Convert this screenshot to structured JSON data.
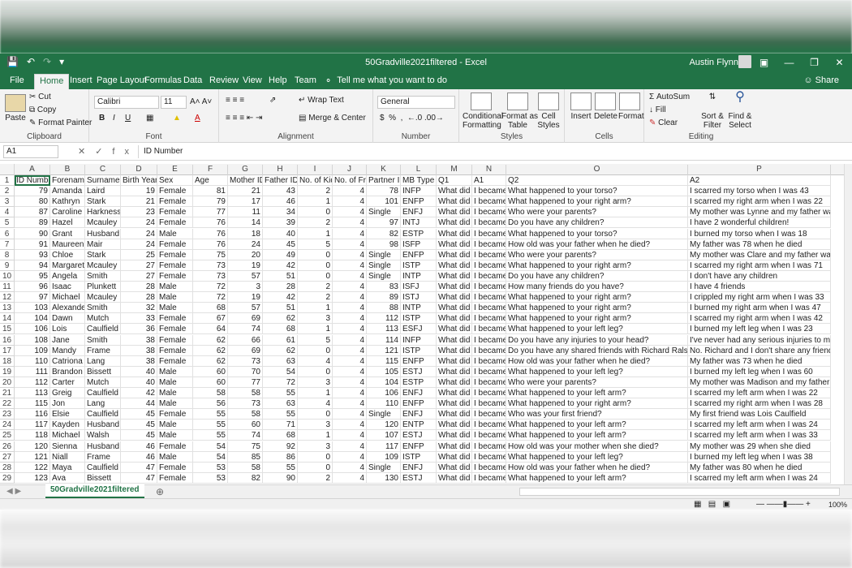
{
  "titlebar": {
    "doc_title": "50Gradville2021filtered  -  Excel",
    "user": "Austin Flynn",
    "save_icon": "save-icon",
    "undo_icon": "undo-icon",
    "redo_icon": "redo-icon"
  },
  "tabs": [
    "File",
    "Home",
    "Insert",
    "Page Layout",
    "Formulas",
    "Data",
    "Review",
    "View",
    "Help",
    "Team"
  ],
  "tellme": "Tell me what you want to do",
  "share": "Share",
  "ribbon": {
    "clipboard": {
      "label": "Clipboard",
      "paste": "Paste",
      "cut": "Cut",
      "copy": "Copy",
      "painter": "Format Painter"
    },
    "font": {
      "label": "Font",
      "name": "Calibri",
      "size": "11"
    },
    "alignment": {
      "label": "Alignment",
      "wrap": "Wrap Text",
      "merge": "Merge & Center"
    },
    "number": {
      "label": "Number",
      "format": "General"
    },
    "styles": {
      "label": "Styles",
      "cond": "Conditional\nFormatting",
      "table": "Format as\nTable",
      "cell": "Cell\nStyles"
    },
    "cells": {
      "label": "Cells",
      "insert": "Insert",
      "delete": "Delete",
      "format": "Format"
    },
    "editing": {
      "label": "Editing",
      "autosum": "AutoSum",
      "fill": "Fill",
      "clear": "Clear",
      "sort": "Sort &\nFilter",
      "find": "Find &\nSelect"
    }
  },
  "formula_bar": {
    "name_box": "A1",
    "formula": "ID Number"
  },
  "columns": [
    "A",
    "B",
    "C",
    "D",
    "E",
    "F",
    "G",
    "H",
    "I",
    "J",
    "K",
    "L",
    "M",
    "N",
    "O",
    "P"
  ],
  "headers": [
    "ID Numbe",
    "Forename",
    "Surname",
    "Birth Year",
    "Sex",
    "Age",
    "Mother ID",
    "Father ID",
    "No. of Kids",
    "No. of Frie",
    "Partner ID",
    "MB Type",
    "Q1",
    "A1",
    "Q2",
    "A2"
  ],
  "rows": [
    [
      "79",
      "Amanda",
      "Laird",
      "19",
      "Female",
      "81",
      "21",
      "43",
      "2",
      "4",
      "78",
      "INFP",
      "What did y",
      "I became a",
      "What happened to your torso?",
      "I scarred my torso when I was 43"
    ],
    [
      "80",
      "Kathryn",
      "Stark",
      "21",
      "Female",
      "79",
      "17",
      "46",
      "1",
      "4",
      "101",
      "ENFP",
      "What did y",
      "I became a",
      "What happened to your right arm?",
      "I scarred my right arm when I was 22"
    ],
    [
      "87",
      "Caroline",
      "Harkness",
      "23",
      "Female",
      "77",
      "11",
      "34",
      "0",
      "4",
      "Single",
      "ENFJ",
      "What did y",
      "I became a",
      "Who were your parents?",
      "My mother was Lynne and my father was Gra"
    ],
    [
      "89",
      "Hazel",
      "Mcauley",
      "24",
      "Female",
      "76",
      "14",
      "39",
      "2",
      "4",
      "97",
      "INTJ",
      "What did y",
      "I became a",
      "Do you have any children?",
      "I have 2 wonderful children!"
    ],
    [
      "90",
      "Grant",
      "Husband",
      "24",
      "Male",
      "76",
      "18",
      "40",
      "1",
      "4",
      "82",
      "ESTP",
      "What did y",
      "I became a",
      "What happened to your torso?",
      "I burned my torso when I was 18"
    ],
    [
      "91",
      "Maureen",
      "Mair",
      "24",
      "Female",
      "76",
      "24",
      "45",
      "5",
      "4",
      "98",
      "ISFP",
      "What did y",
      "I became a",
      "How old was your father when he died?",
      "My father was 78 when he died"
    ],
    [
      "93",
      "Chloe",
      "Stark",
      "25",
      "Female",
      "75",
      "20",
      "49",
      "0",
      "4",
      "Single",
      "ENFP",
      "What did y",
      "I became a",
      "Who were your parents?",
      "My mother was Clare and my father was Tayl"
    ],
    [
      "94",
      "Margaret",
      "Mcauley",
      "27",
      "Female",
      "73",
      "19",
      "42",
      "0",
      "4",
      "Single",
      "ISTP",
      "What did y",
      "I became a",
      "What happened to your right arm?",
      "I scarred my right arm when I was 71"
    ],
    [
      "95",
      "Angela",
      "Smith",
      "27",
      "Female",
      "73",
      "57",
      "51",
      "0",
      "4",
      "Single",
      "INTP",
      "What did y",
      "I became a",
      "Do you have any children?",
      "I don't have any children"
    ],
    [
      "96",
      "Isaac",
      "Plunkett",
      "28",
      "Male",
      "72",
      "3",
      "28",
      "2",
      "4",
      "83",
      "ISFJ",
      "What did y",
      "I became a",
      "How many friends do you have?",
      "I have 4 friends"
    ],
    [
      "97",
      "Michael",
      "Mcauley",
      "28",
      "Male",
      "72",
      "19",
      "42",
      "2",
      "4",
      "89",
      "ISTJ",
      "What did y",
      "I became a",
      "What happened to your right arm?",
      "I crippled my right arm when I was 33"
    ],
    [
      "103",
      "Alexander",
      "Smith",
      "32",
      "Male",
      "68",
      "57",
      "51",
      "1",
      "4",
      "88",
      "INTP",
      "What did y",
      "I became a",
      "What happened to your right arm?",
      "I burned my right arm when I was 47"
    ],
    [
      "104",
      "Dawn",
      "Mutch",
      "33",
      "Female",
      "67",
      "69",
      "62",
      "3",
      "4",
      "112",
      "ISTP",
      "What did y",
      "I became a",
      "What happened to your right arm?",
      "I scarred my right arm when I was 42"
    ],
    [
      "106",
      "Lois",
      "Caulfield",
      "36",
      "Female",
      "64",
      "74",
      "68",
      "1",
      "4",
      "113",
      "ESFJ",
      "What did y",
      "I became a",
      "What happened to your left leg?",
      "I burned my left leg when I was 23"
    ],
    [
      "108",
      "Jane",
      "Smith",
      "38",
      "Female",
      "62",
      "66",
      "61",
      "5",
      "4",
      "114",
      "INFP",
      "What did y",
      "I became a",
      "Do you have any injuries to your head?",
      "I've never had any serious injuries to my head"
    ],
    [
      "109",
      "Mandy",
      "Frame",
      "38",
      "Female",
      "62",
      "69",
      "62",
      "0",
      "4",
      "121",
      "ISTP",
      "What did y",
      "I became a",
      "Do you have any shared friends with Richard Ralston?",
      "No. Richard and I don't share any friends"
    ],
    [
      "110",
      "Catriona",
      "Lang",
      "38",
      "Female",
      "62",
      "73",
      "63",
      "4",
      "4",
      "115",
      "ENFP",
      "What did y",
      "I became a",
      "How old was your father when he died?",
      "My father was 73 when he died"
    ],
    [
      "111",
      "Brandon",
      "Bissett",
      "40",
      "Male",
      "60",
      "70",
      "54",
      "0",
      "4",
      "105",
      "ESTJ",
      "What did y",
      "I became a",
      "What happened to your left leg?",
      "I burned my left leg when I was 60"
    ],
    [
      "112",
      "Carter",
      "Mutch",
      "40",
      "Male",
      "60",
      "77",
      "72",
      "3",
      "4",
      "104",
      "ESTP",
      "What did y",
      "I became a",
      "Who were your parents?",
      "My mother was Madison and my father was I"
    ],
    [
      "113",
      "Greig",
      "Caulfield",
      "42",
      "Male",
      "58",
      "58",
      "55",
      "1",
      "4",
      "106",
      "ENFJ",
      "What did y",
      "I became a",
      "What happened to your left arm?",
      "I scarred my left arm when I was 22"
    ],
    [
      "115",
      "Jon",
      "Lang",
      "44",
      "Male",
      "56",
      "73",
      "63",
      "4",
      "4",
      "110",
      "ENFP",
      "What did y",
      "I became a",
      "What happened to your right arm?",
      "I scarred my right arm when I was 28"
    ],
    [
      "116",
      "Elsie",
      "Caulfield",
      "45",
      "Female",
      "55",
      "58",
      "55",
      "0",
      "4",
      "Single",
      "ENFJ",
      "What did y",
      "I became a",
      "Who was your first friend?",
      "My first friend was Lois Caulfield"
    ],
    [
      "117",
      "Kayden",
      "Husband",
      "45",
      "Male",
      "55",
      "60",
      "71",
      "3",
      "4",
      "120",
      "ENTP",
      "What did y",
      "I became a",
      "What happened to your left arm?",
      "I scarred my left arm when I was 24"
    ],
    [
      "118",
      "Michael",
      "Walsh",
      "45",
      "Male",
      "55",
      "74",
      "68",
      "1",
      "4",
      "107",
      "ESTJ",
      "What did y",
      "I became a",
      "What happened to your left arm?",
      "I scarred my left arm when I was 33"
    ],
    [
      "120",
      "Sienna",
      "Husband",
      "46",
      "Female",
      "54",
      "75",
      "92",
      "3",
      "4",
      "117",
      "ENFP",
      "What did y",
      "I became a",
      "How old was your mother when she died?",
      "My mother was 29 when she died"
    ],
    [
      "121",
      "Niall",
      "Frame",
      "46",
      "Male",
      "54",
      "85",
      "86",
      "0",
      "4",
      "109",
      "ISTP",
      "What did y",
      "I became a",
      "What happened to your left leg?",
      "I burned my left leg when I was 38"
    ],
    [
      "122",
      "Maya",
      "Caulfield",
      "47",
      "Female",
      "53",
      "58",
      "55",
      "0",
      "4",
      "Single",
      "ENFJ",
      "What did y",
      "I became a",
      "How old was your father when he died?",
      "My father was 80 when he died"
    ],
    [
      "123",
      "Ava",
      "Bissett",
      "47",
      "Female",
      "53",
      "82",
      "90",
      "2",
      "4",
      "130",
      "ESTJ",
      "What did y",
      "I became a",
      "What happened to your left arm?",
      "I scarred my left arm when I was 24"
    ]
  ],
  "sheet_tab": "50Gradville2021filtered",
  "zoom": "100%"
}
